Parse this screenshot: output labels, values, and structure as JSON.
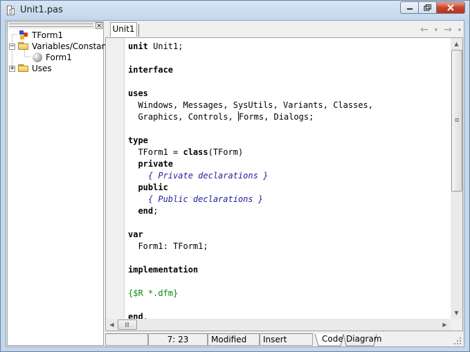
{
  "window": {
    "title": "Unit1.pas",
    "controls": {
      "minimize": "minimize",
      "maximize": "maximize",
      "close": "close"
    }
  },
  "tree": {
    "items": [
      {
        "label": "TForm1",
        "level": 1,
        "icon": "class-icon",
        "expander": ""
      },
      {
        "label": "Variables/Constants",
        "level": 1,
        "icon": "folder-icon",
        "expander": "−"
      },
      {
        "label": "Form1",
        "level": 2,
        "icon": "object-icon",
        "expander": ""
      },
      {
        "label": "Uses",
        "level": 1,
        "icon": "folder-icon",
        "expander": "+"
      }
    ],
    "close_label": "×"
  },
  "editor": {
    "tab_label": "Unit1",
    "nav": {
      "back": "←",
      "dropdown": "▾",
      "forward": "→",
      "dropdown2": "▾"
    },
    "code_lines": [
      [
        {
          "t": "unit",
          "k": "kw"
        },
        {
          "t": " Unit1;",
          "k": ""
        }
      ],
      [],
      [
        {
          "t": "interface",
          "k": "kw"
        }
      ],
      [],
      [
        {
          "t": "uses",
          "k": "kw"
        }
      ],
      [
        {
          "t": "  Windows, Messages, SysUtils, Variants, Classes,",
          "k": ""
        }
      ],
      [
        {
          "t": "  Graphics, Controls, ",
          "k": ""
        },
        {
          "t": "",
          "k": "caret"
        },
        {
          "t": "Forms, Dialogs;",
          "k": ""
        }
      ],
      [],
      [
        {
          "t": "type",
          "k": "kw"
        }
      ],
      [
        {
          "t": "  TForm1 = ",
          "k": ""
        },
        {
          "t": "class",
          "k": "kw"
        },
        {
          "t": "(TForm)",
          "k": ""
        }
      ],
      [
        {
          "t": "  ",
          "k": ""
        },
        {
          "t": "private",
          "k": "kw"
        }
      ],
      [
        {
          "t": "    ",
          "k": ""
        },
        {
          "t": "{ Private declarations }",
          "k": "cm"
        }
      ],
      [
        {
          "t": "  ",
          "k": ""
        },
        {
          "t": "public",
          "k": "kw"
        }
      ],
      [
        {
          "t": "    ",
          "k": ""
        },
        {
          "t": "{ Public declarations }",
          "k": "cm"
        }
      ],
      [
        {
          "t": "  ",
          "k": ""
        },
        {
          "t": "end",
          "k": "kw"
        },
        {
          "t": ";",
          "k": ""
        }
      ],
      [],
      [
        {
          "t": "var",
          "k": "kw"
        }
      ],
      [
        {
          "t": "  Form1: TForm1;",
          "k": ""
        }
      ],
      [],
      [
        {
          "t": "implementation",
          "k": "kw"
        }
      ],
      [],
      [
        {
          "t": "{$R *.dfm}",
          "k": "dir"
        }
      ],
      [],
      [
        {
          "t": "end",
          "k": "kw"
        },
        {
          "t": ".",
          "k": ""
        }
      ]
    ]
  },
  "status": {
    "position": "7: 23",
    "modified": "Modified",
    "mode": "Insert",
    "tabs": [
      "Code",
      "Diagram"
    ]
  }
}
